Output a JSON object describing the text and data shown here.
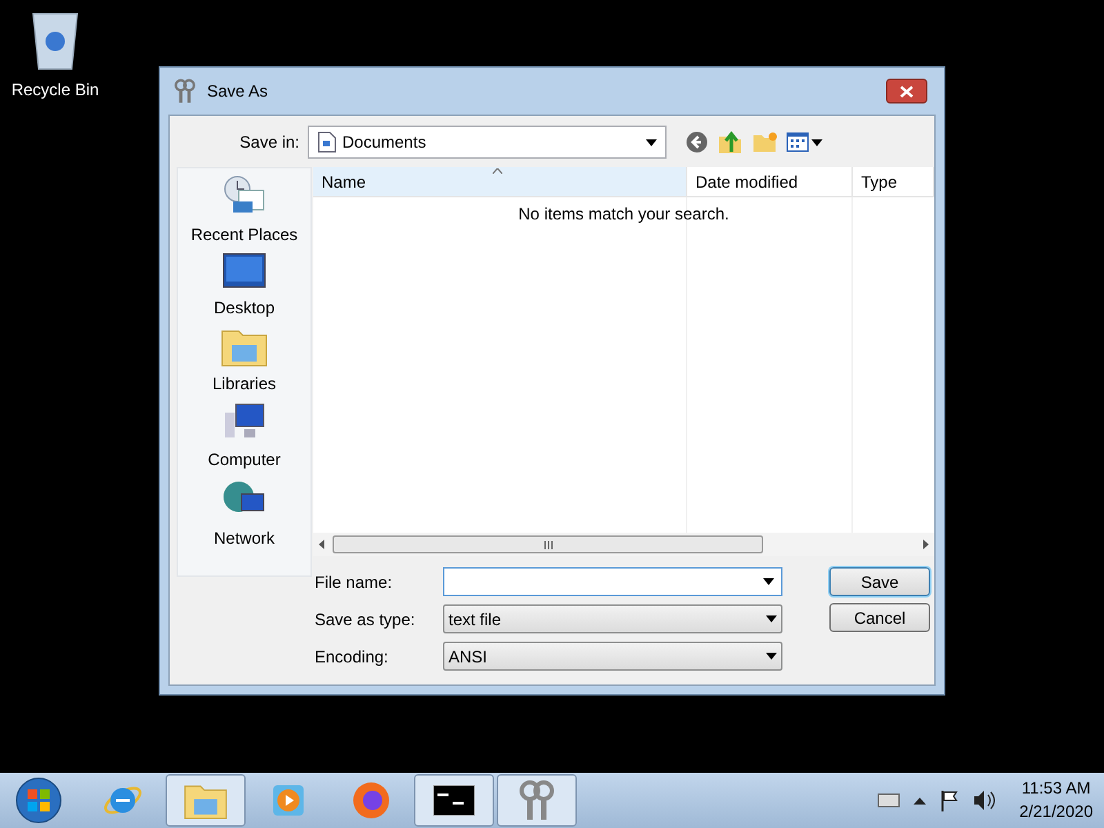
{
  "desktop_icons": [
    {
      "label": "Recycle Bin"
    }
  ],
  "dialog": {
    "title": "Save As",
    "save_in": {
      "label": "Save in:",
      "value": "Documents"
    },
    "places": [
      {
        "label": "Recent Places",
        "kind": "recent"
      },
      {
        "label": "Desktop",
        "kind": "desktop"
      },
      {
        "label": "Libraries",
        "kind": "libraries"
      },
      {
        "label": "Computer",
        "kind": "computer"
      },
      {
        "label": "Network",
        "kind": "network"
      }
    ],
    "columns": [
      {
        "label": "Name",
        "sorted": true
      },
      {
        "label": "Date modified",
        "sorted": false
      },
      {
        "label": "Type",
        "sorted": false
      }
    ],
    "empty_message": "No items match your search.",
    "fields": [
      {
        "label": "File name:",
        "kind": "edit"
      },
      {
        "label": "Save as type:",
        "value": "text file",
        "kind": "select"
      },
      {
        "label": "Encoding:",
        "value": "ANSI",
        "kind": "select"
      }
    ],
    "buttons": [
      {
        "label": "Save",
        "default": true
      },
      {
        "label": "Cancel",
        "default": false
      }
    ]
  },
  "taskbar": {
    "items": [
      {
        "kind": "ie",
        "open": false
      },
      {
        "kind": "explorer",
        "open": true
      },
      {
        "kind": "media",
        "open": false
      },
      {
        "kind": "firefox",
        "open": false
      },
      {
        "kind": "cmd",
        "open": true
      },
      {
        "kind": "keys",
        "open": true
      }
    ],
    "time": "11:53 AM",
    "date": "2/21/2020"
  }
}
